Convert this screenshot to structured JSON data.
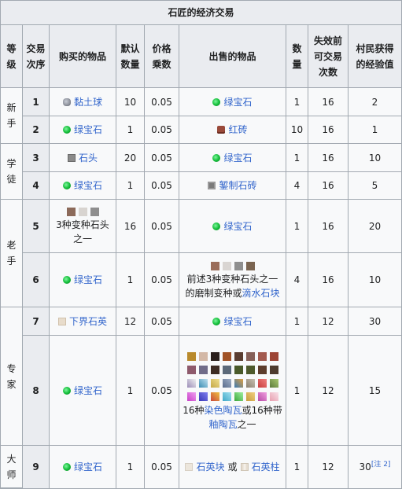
{
  "caption": "石匠的经济交易",
  "headers": {
    "level": [
      "等",
      "级"
    ],
    "order": [
      "交易",
      "次序"
    ],
    "buy": "购买的物品",
    "default_qty": [
      "默认",
      "数量"
    ],
    "price_mult": [
      "价格",
      "乘数"
    ],
    "sell": "出售的物品",
    "qty": [
      "数",
      "量"
    ],
    "max_uses": [
      "失效前",
      "可交易",
      "次数"
    ],
    "xp": [
      "村民获得",
      "的经验值"
    ]
  },
  "levels": [
    {
      "chars": [
        "新",
        "手"
      ]
    },
    {
      "chars": [
        "学",
        "徒"
      ]
    },
    {
      "chars": [
        "老",
        "手"
      ]
    },
    {
      "chars": [
        "专",
        "家"
      ]
    },
    {
      "chars": [
        "大",
        "师"
      ]
    }
  ],
  "rows": [
    {
      "order": "1",
      "buy": "黏土球",
      "buy_icon": "clay-ball-icon",
      "default_qty": "10",
      "price_mult": "0.05",
      "sell": "绿宝石",
      "sell_icon": "emerald-icon",
      "qty": "1",
      "max_uses": "16",
      "xp": "2"
    },
    {
      "order": "2",
      "buy": "绿宝石",
      "buy_icon": "emerald-icon",
      "default_qty": "1",
      "price_mult": "0.05",
      "sell": "红砖",
      "sell_icon": "brick-icon",
      "qty": "10",
      "max_uses": "16",
      "xp": "1"
    },
    {
      "order": "3",
      "buy": "石头",
      "buy_icon": "stone-icon",
      "default_qty": "20",
      "price_mult": "0.05",
      "sell": "绿宝石",
      "sell_icon": "emerald-icon",
      "qty": "1",
      "max_uses": "16",
      "xp": "10"
    },
    {
      "order": "4",
      "buy": "绿宝石",
      "buy_icon": "emerald-icon",
      "default_qty": "1",
      "price_mult": "0.05",
      "sell": "錾制石砖",
      "sell_icon": "chiseled-stone-bricks-icon",
      "qty": "4",
      "max_uses": "16",
      "xp": "5"
    },
    {
      "order": "5",
      "buy_lines": [
        "3种变种石头",
        "之一"
      ],
      "buy_link": "石头",
      "default_qty": "16",
      "price_mult": "0.05",
      "sell": "绿宝石",
      "sell_icon": "emerald-icon",
      "qty": "1",
      "max_uses": "16",
      "xp": "20"
    },
    {
      "order": "6",
      "buy": "绿宝石",
      "buy_icon": "emerald-icon",
      "default_qty": "1",
      "price_mult": "0.05",
      "sell_lines": [
        "前述3种变种石头之一",
        "的磨制变种或",
        "滴水石块"
      ],
      "qty": "4",
      "max_uses": "16",
      "xp": "10"
    },
    {
      "order": "7",
      "buy": "下界石英",
      "buy_icon": "nether-quartz-icon",
      "default_qty": "12",
      "price_mult": "0.05",
      "sell": "绿宝石",
      "sell_icon": "emerald-icon",
      "qty": "1",
      "max_uses": "12",
      "xp": "30"
    },
    {
      "order": "8",
      "buy": "绿宝石",
      "buy_icon": "emerald-icon",
      "default_qty": "1",
      "price_mult": "0.05",
      "sell_lines": [
        "16种",
        "染色陶瓦",
        "或",
        "16种",
        "带",
        "釉陶瓦",
        "之一"
      ],
      "qty": "1",
      "max_uses": "12",
      "xp": "15"
    },
    {
      "order": "9",
      "buy": "绿宝石",
      "buy_icon": "emerald-icon",
      "default_qty": "1",
      "price_mult": "0.05",
      "sell": "石英块",
      "sell_icon": "quartz-block-icon",
      "sell_or": "或",
      "sell2": "石英柱",
      "sell2_icon": "quartz-pillar-icon",
      "qty": "1",
      "max_uses": "12",
      "xp": "30",
      "xp_note": "[注 2]"
    }
  ],
  "colors": {
    "header_bg": "#eaecf0",
    "body_bg": "#f8f9fa",
    "border": "#a2a9b1",
    "link": "#3366cc",
    "text": "#202122"
  },
  "swatches": {
    "stone_variants": [
      "#8c6a5a",
      "#d8d4d0",
      "#8e8e8e"
    ],
    "polished_variants": [
      "#9a6d5a",
      "#d9d5d2",
      "#8f8f8f",
      "#7a6450"
    ],
    "terracotta_row1": [
      "#b98a2c",
      "#d3b8a6",
      "#2b201c",
      "#a05226",
      "#5a3d30",
      "#866058",
      "#a25a4e",
      "#9c4434"
    ],
    "terracotta_row2": [
      "#8e5a6c",
      "#706c89",
      "#3d2c24",
      "#5c6a7a",
      "#4a5a2a",
      "#4e5a2c",
      "#5d3d2c",
      "#4e3b2e"
    ],
    "glazed_row1": [
      "#9a8cb8",
      "#3d8eb4",
      "#c4a848",
      "#5a6c8c",
      "#3a7ab4",
      "#8a8070",
      "#c83c3c",
      "#5c7a3c"
    ],
    "glazed_row2": [
      "#c840c8",
      "#3a3ab8",
      "#c8483c",
      "#40a8c8",
      "#3ca83c",
      "#c89c3c",
      "#b84ca8",
      "#e8a0b0"
    ]
  }
}
